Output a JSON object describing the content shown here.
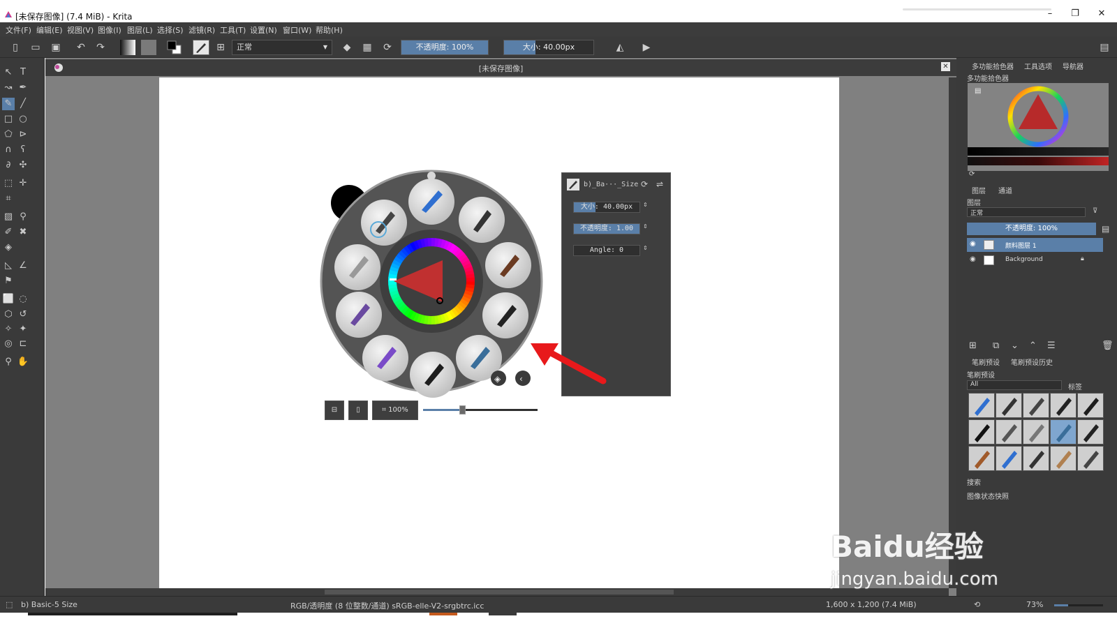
{
  "titlebar": {
    "title": "[未保存图像]  (7.4 MiB)  - Krita",
    "minimize": "–",
    "restore": "❐",
    "close": "✕"
  },
  "menu": [
    "文件(F)",
    "编辑(E)",
    "视图(V)",
    "图像(I)",
    "图层(L)",
    "选择(S)",
    "滤镜(R)",
    "工具(T)",
    "设置(N)",
    "窗口(W)",
    "帮助(H)"
  ],
  "toolbar": {
    "blend_mode": "正常",
    "opacity_label": "不透明度: 100%",
    "opacity_value": 1.0,
    "size_label": "大小: 40.00px",
    "size_fill": 0.35
  },
  "document": {
    "tab_title": "[未保存图像]"
  },
  "popup": {
    "zoom_label": "100%",
    "slider_value": 0.34
  },
  "brush_editor": {
    "preset_name": "b)_Ba···_Size",
    "size_label": "大小: 40.00px",
    "size_fill": 0.33,
    "opacity_label": "不透明度: 1.00",
    "opacity_fill": 1.0,
    "angle_label": "Angle: 0",
    "angle_fill": 0.0
  },
  "right_panel": {
    "top_tabs": [
      "多功能拾色器",
      "工具选项",
      "导航器"
    ],
    "color_docker_title": "多功能拾色器",
    "layer_tabs": [
      "图层",
      "通道"
    ],
    "layers_title": "图层",
    "blend_mode": "正常",
    "layer_opacity": "不透明度:  100%",
    "layers": [
      {
        "name": "颜料图层 1",
        "active": true
      },
      {
        "name": "Background",
        "active": false
      }
    ],
    "preset_tabs": [
      "笔刷预设",
      "笔刷预设历史"
    ],
    "presets_title": "笔刷预设",
    "preset_filter": "All",
    "preset_tag": "标签",
    "search_label": "搜索",
    "snapshot_title": "图像状态快照"
  },
  "status": {
    "brush": "b) Basic-5 Size",
    "color_profile": "RGB/透明度 (8 位整数/通道)  sRGB-elle-V2-srgbtrc.icc",
    "image_size": "1,600 x 1,200 (7.4 MiB)",
    "zoom": "73%"
  },
  "watermark": {
    "logo": "Baidu经验",
    "url": "jingyan.baidu.com"
  },
  "colors": {
    "accent": "#5a7fa8",
    "arrow": "#e8191b",
    "panel": "#3a3a3a"
  }
}
